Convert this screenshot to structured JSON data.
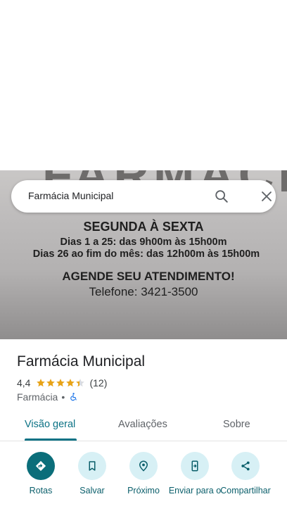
{
  "photo": {
    "watermark": "FARMÁCIA",
    "line1": "SEGUNDA À SEXTA",
    "line2": "Dias 1 a 25: das 9h00m às 15h00m",
    "line3": "Dias 26 ao fim do mês: das 12h00m às 15h00m",
    "line4": "AGENDE SEU ATENDIMENTO!",
    "line5": "Telefone: 3421-3500"
  },
  "search": {
    "query": "Farmácia Municipal",
    "search_icon": "search-icon",
    "close_icon": "close-icon"
  },
  "place": {
    "name": "Farmácia Municipal",
    "rating": "4,4",
    "stars": 4.4,
    "review_count": "(12)",
    "category": "Farmácia",
    "separator": "•",
    "accessibility_icon": "wheelchair-icon"
  },
  "tabs": [
    {
      "label": "Visão geral",
      "active": true
    },
    {
      "label": "Avaliações",
      "active": false
    },
    {
      "label": "Sobre",
      "active": false
    }
  ],
  "actions": [
    {
      "label": "Rotas",
      "icon": "directions-icon"
    },
    {
      "label": "Salvar",
      "icon": "bookmark-icon"
    },
    {
      "label": "Próximo",
      "icon": "nearby-icon"
    },
    {
      "label": "Enviar para o",
      "icon": "send-to-phone-icon"
    },
    {
      "label": "Compartilhar",
      "icon": "share-icon"
    }
  ],
  "colors": {
    "accent": "#0b7285",
    "primary_action": "#0b6e7a",
    "action_bg": "#d7f0f5",
    "star": "#e8a317"
  }
}
